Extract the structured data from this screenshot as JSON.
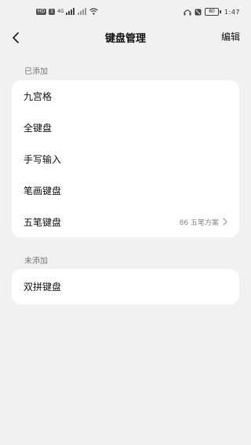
{
  "status_bar": {
    "hd_badge": "HD",
    "sim": "1",
    "network": "4G",
    "battery": "80",
    "time": "1:47",
    "icons": [
      "signal-icon",
      "wifi-icon",
      "headphones-icon",
      "mute-icon",
      "battery-icon"
    ]
  },
  "header": {
    "title": "键盘管理",
    "edit_label": "编辑",
    "back_icon": "chevron-left-icon"
  },
  "added": {
    "label": "已添加",
    "items": [
      {
        "label": "九宫格"
      },
      {
        "label": "全键盘"
      },
      {
        "label": "手写输入"
      },
      {
        "label": "笔画键盘"
      },
      {
        "label": "五笔键盘",
        "detail": "86 五笔方案"
      }
    ]
  },
  "not_added": {
    "label": "未添加",
    "items": [
      {
        "label": "双拼键盘"
      }
    ]
  }
}
